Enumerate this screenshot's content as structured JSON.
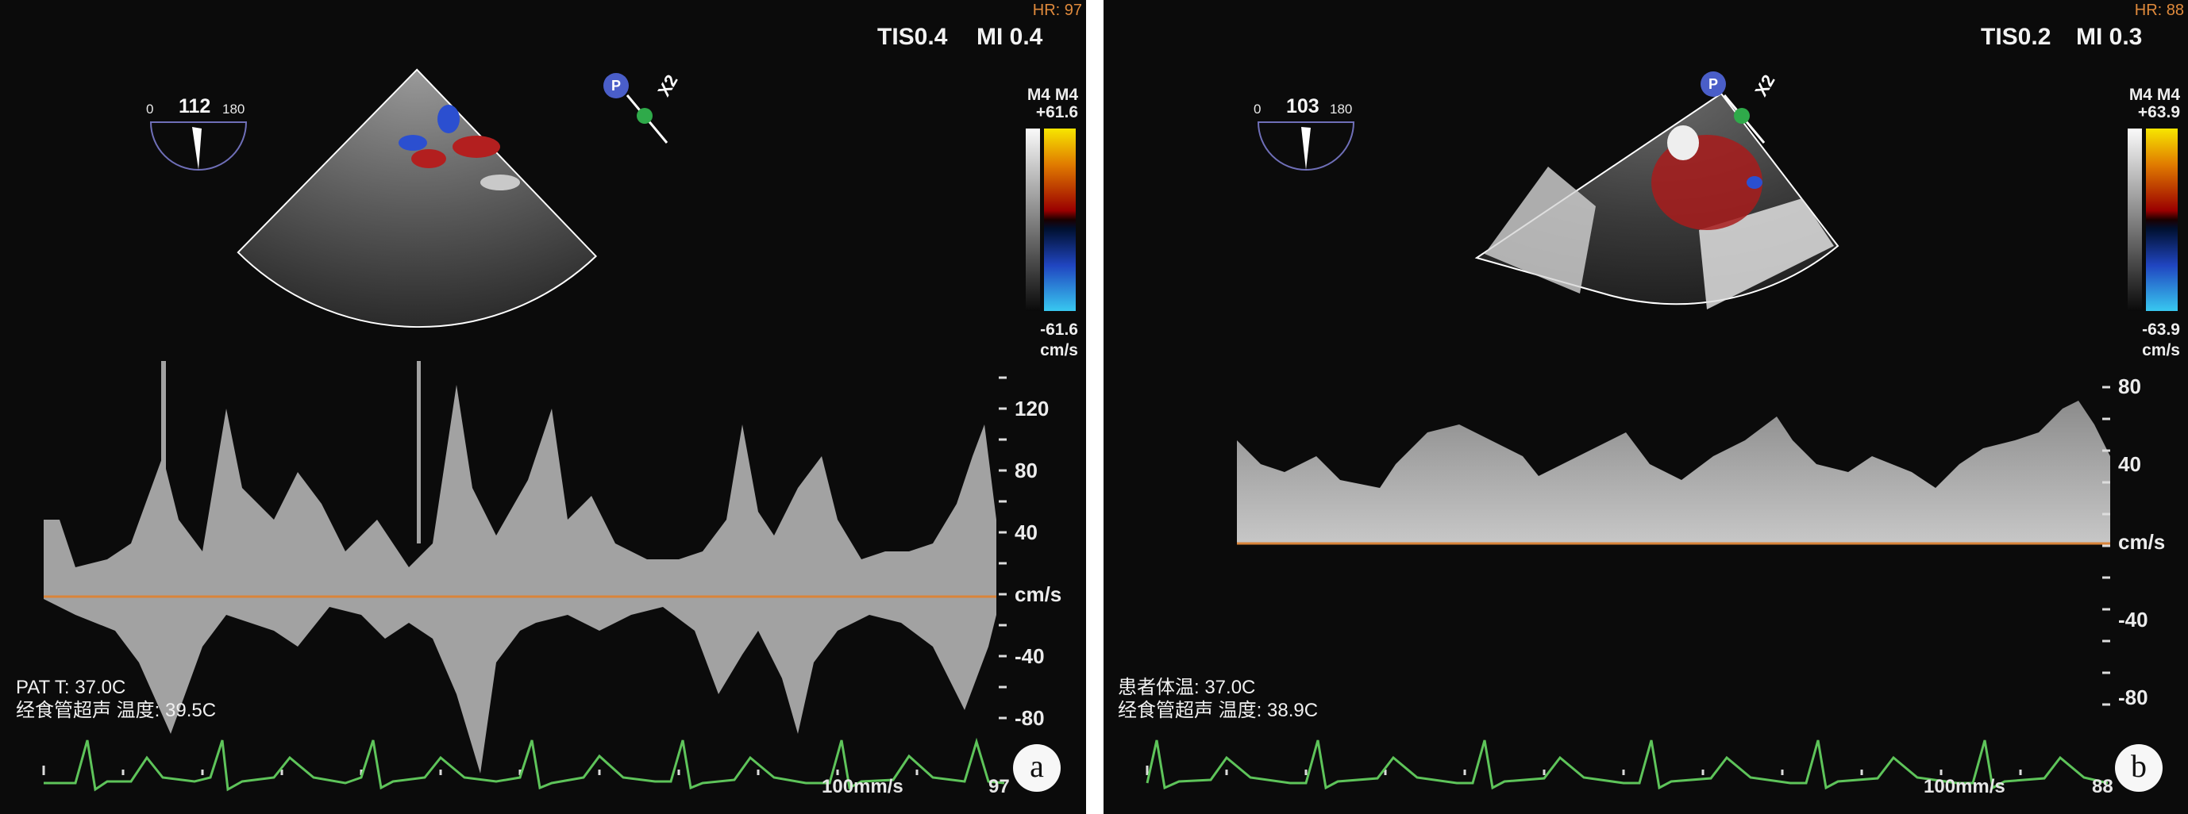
{
  "figure": {
    "panels": [
      {
        "label": "a",
        "hr": "HR: 97",
        "tis": "TIS0.4",
        "mi": "MI 0.4",
        "angle": {
          "min": "0",
          "value": "112",
          "max": "180",
          "value_deg": 112
        },
        "color_map": "M4 M4",
        "scale_max": "+61.6",
        "scale_min": "-61.6",
        "scale_unit": "cm/s",
        "velocity_ticks": [
          "120",
          "80",
          "40",
          "cm/s",
          "-40",
          "-80"
        ],
        "info_lines": [
          "PAT T: 37.0C",
          "经食管超声 温度: 39.5C"
        ],
        "sweep_speed": "100mm/s",
        "corner_value": "97"
      },
      {
        "label": "b",
        "hr": "HR: 88",
        "tis": "TIS0.2",
        "mi": "MI 0.3",
        "angle": {
          "min": "0",
          "value": "103",
          "max": "180",
          "value_deg": 103
        },
        "color_map": "M4 M4",
        "scale_max": "+63.9",
        "scale_min": "-63.9",
        "scale_unit": "cm/s",
        "velocity_ticks": [
          "80",
          "40",
          "cm/s",
          "-40",
          "-80"
        ],
        "info_lines": [
          "患者体温: 37.0C",
          "经食管超声 温度: 38.9C"
        ],
        "sweep_speed": "100mm/s",
        "corner_value": "88"
      }
    ],
    "probe_marker": "P",
    "zoom_label": "X2",
    "colors": {
      "background": "#0b0b0b",
      "baseline": "#d9843a",
      "ecg": "#5ec45a",
      "hr_text": "#e08a3c"
    }
  }
}
